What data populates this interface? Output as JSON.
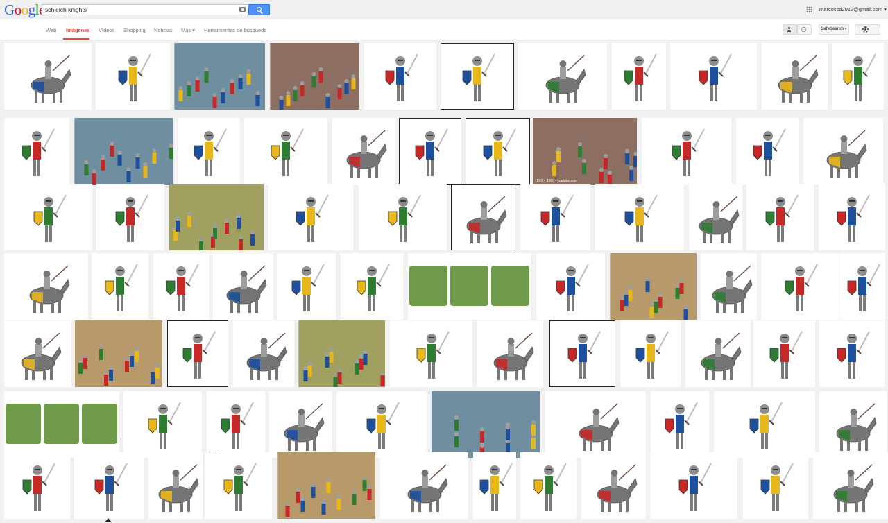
{
  "logo": [
    "G",
    "o",
    "o",
    "g",
    "l",
    "e"
  ],
  "logo_colors": [
    "#3369e8",
    "#d50f25",
    "#eeb211",
    "#3369e8",
    "#009925",
    "#d50f25"
  ],
  "search": {
    "query": "schleich knights"
  },
  "account": {
    "email": "marcoscd2012@gmail.com ▾"
  },
  "nav": {
    "items": [
      "Web",
      "Imágenes",
      "Vídeos",
      "Shopping",
      "Noticias",
      "Más ▾",
      "Herramientas de búsqueda"
    ],
    "active_index": 1
  },
  "tools": {
    "safesearch_label": "SafeSearch ▾"
  },
  "results": {
    "caption": "1920 × 1080 - youtube.com",
    "watermark": "MJSToy.com",
    "accent_colors": [
      "#c62828",
      "#1e4f9c",
      "#e8b71a",
      "#2e7d32",
      "#5d4037",
      "#757575",
      "#f3f0ea"
    ]
  }
}
